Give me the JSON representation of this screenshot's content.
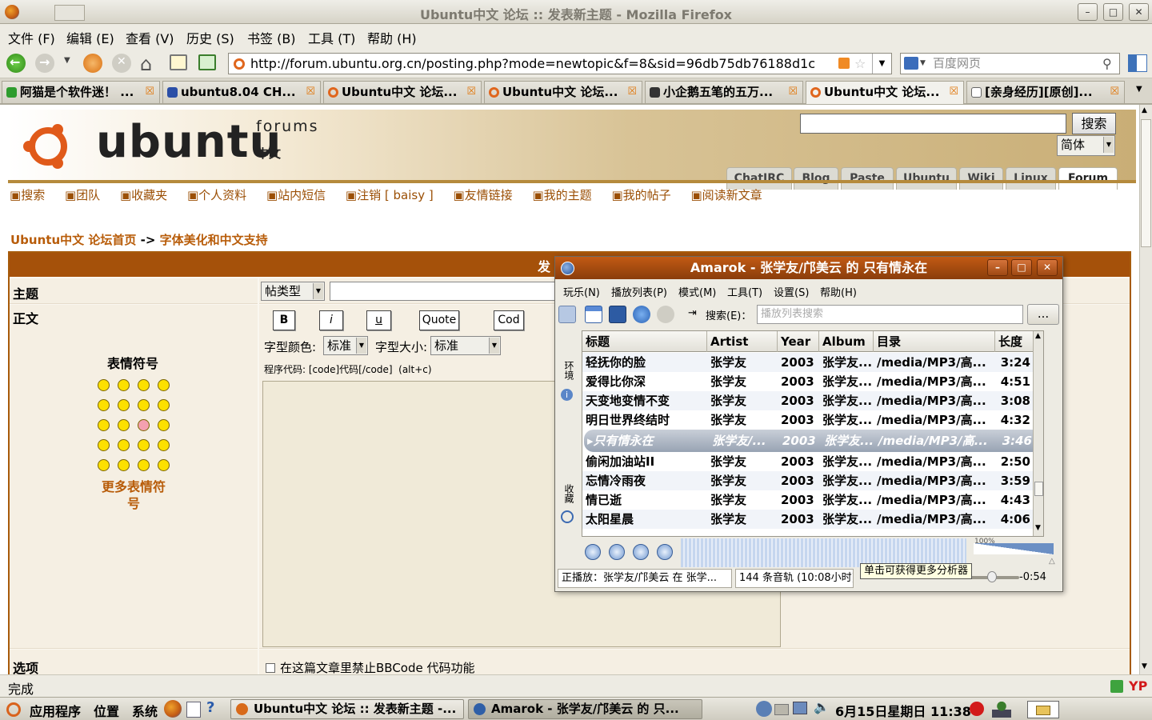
{
  "window": {
    "title": "Ubuntu中文 论坛 :: 发表新主题 - Mozilla Firefox"
  },
  "menu": [
    "文件 (F)",
    "编辑 (E)",
    "查看 (V)",
    "历史 (S)",
    "书签 (B)",
    "工具 (T)",
    "帮助 (H)"
  ],
  "nav": {
    "url": "http://forum.ubuntu.org.cn/posting.php?mode=newtopic&f=8&sid=96db75db76188d1c",
    "search_placeholder": "百度网页"
  },
  "tabs": [
    {
      "label": "阿猫是个软件迷！ ..."
    },
    {
      "label": "ubuntu8.04 CH..."
    },
    {
      "label": "Ubuntu中文 论坛..."
    },
    {
      "label": "Ubuntu中文 论坛..."
    },
    {
      "label": "小企鹅五笔的五万..."
    },
    {
      "label": "Ubuntu中文 论坛..."
    },
    {
      "label": "[亲身经历][原创]..."
    }
  ],
  "site": {
    "logo": "ubuntu",
    "logo_sub": "forums",
    "logo_lang": "中文",
    "search_button": "搜索",
    "lang_select": "简体",
    "nav_tabs": [
      "ChatIRC",
      "Blog",
      "Paste",
      "Ubuntu",
      "Wiki",
      "Linux",
      "Forum"
    ],
    "links": [
      "搜索",
      "团队",
      "收藏夹",
      "个人资料",
      "站内短信",
      "注销 [ baisy ]",
      "友情链接",
      "我的主题",
      "我的帖子",
      "阅读新文章"
    ],
    "breadcrumb_home": "Ubuntu中文 论坛首页",
    "breadcrumb_sep": "->",
    "breadcrumb_forum": "字体美化和中文支持"
  },
  "form": {
    "header": "发",
    "subject_label": "主题",
    "post_type": "帖类型",
    "body_label": "正文",
    "smilies_title": "表情符号",
    "more_smilies": "更多表情符号",
    "buttons": [
      "B",
      "i",
      "u",
      "Quote",
      "Cod"
    ],
    "color_label": "字型颜色:",
    "color_value": "标准",
    "size_label": "字型大小:",
    "size_value": "标准",
    "code_hint": "程序代码: [code]代码[/code]  (alt+c)",
    "options_label": "选项",
    "option1": "在这篇文章里禁止BBCode 代码功能"
  },
  "status": {
    "text": "完成",
    "addon": "YP"
  },
  "taskbar": {
    "menus": [
      "应用程序",
      "位置",
      "系统"
    ],
    "tasks": [
      "Ubuntu中文 论坛 :: 发表新主题 -...",
      "Amarok - 张学友/邝美云 的 只..."
    ],
    "clock": "6月15日星期日 11:38"
  },
  "amarok": {
    "title": "Amarok - 张学友/邝美云 的 只有情永在",
    "menu": [
      "玩乐(N)",
      "播放列表(P)",
      "模式(M)",
      "工具(T)",
      "设置(S)",
      "帮助(H)"
    ],
    "search_label": "搜索(E)：",
    "search_placeholder": "播放列表搜索",
    "side_tabs": [
      "环境",
      "收藏"
    ],
    "columns": [
      "标题",
      "Artist",
      "Year",
      "Album",
      "目录",
      "长度"
    ],
    "rows": [
      {
        "title": "轻抚你的脸",
        "artist": "张学友",
        "year": "2003",
        "album": "张学友...",
        "dir": "/media/MP3/高...",
        "len": "3:24"
      },
      {
        "title": "爱得比你深",
        "artist": "张学友",
        "year": "2003",
        "album": "张学友...",
        "dir": "/media/MP3/高...",
        "len": "4:51"
      },
      {
        "title": "天变地变情不变",
        "artist": "张学友",
        "year": "2003",
        "album": "张学友...",
        "dir": "/media/MP3/高...",
        "len": "3:08"
      },
      {
        "title": "明日世界终结时",
        "artist": "张学友",
        "year": "2003",
        "album": "张学友...",
        "dir": "/media/MP3/高...",
        "len": "4:32"
      },
      {
        "title": "只有情永在",
        "artist": "张学友/...",
        "year": "2003",
        "album": "张学友...",
        "dir": "/media/MP3/高...",
        "len": "3:46",
        "current": true
      },
      {
        "title": "偷闲加油站II",
        "artist": "张学友",
        "year": "2003",
        "album": "张学友...",
        "dir": "/media/MP3/高...",
        "len": "2:50"
      },
      {
        "title": "忘情冷雨夜",
        "artist": "张学友",
        "year": "2003",
        "album": "张学友...",
        "dir": "/media/MP3/高...",
        "len": "3:59"
      },
      {
        "title": "情已逝",
        "artist": "张学友",
        "year": "2003",
        "album": "张学友...",
        "dir": "/media/MP3/高...",
        "len": "4:43"
      },
      {
        "title": "太阳星晨",
        "artist": "张学友",
        "year": "2003",
        "album": "张学友...",
        "dir": "/media/MP3/高...",
        "len": "4:06"
      }
    ],
    "volume": "100%",
    "status_playing": "正播放：张学友/邝美云 在 张学...",
    "status_tracks": "144 条音轨 (10:08小时)",
    "time_remaining": "-0:54",
    "tooltip": "单击可获得更多分析器",
    "more_button": "..."
  }
}
